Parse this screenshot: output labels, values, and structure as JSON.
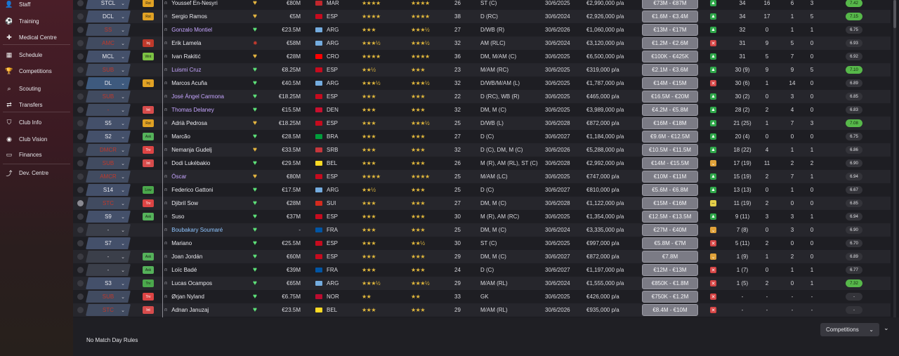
{
  "sidebar": {
    "items": [
      {
        "label": "Staff",
        "icon": "staff-icon",
        "glyph": "👤"
      },
      {
        "label": "Training",
        "icon": "training-icon",
        "glyph": "⚽"
      },
      {
        "label": "Medical Centre",
        "icon": "medical-icon",
        "glyph": "✚"
      },
      {
        "label": "Schedule",
        "icon": "schedule-icon",
        "glyph": "▦"
      },
      {
        "label": "Competitions",
        "icon": "trophy-icon",
        "glyph": "🏆"
      },
      {
        "label": "Scouting",
        "icon": "search-icon",
        "glyph": "⌕"
      },
      {
        "label": "Transfers",
        "icon": "transfers-icon",
        "glyph": "⇄"
      },
      {
        "label": "Club Info",
        "icon": "shield-icon",
        "glyph": "⛉"
      },
      {
        "label": "Club Vision",
        "icon": "eye-icon",
        "glyph": "◉"
      },
      {
        "label": "Finances",
        "icon": "money-icon",
        "glyph": "▭"
      },
      {
        "label": "Dev. Centre",
        "icon": "dev-icon",
        "glyph": "⤴"
      }
    ]
  },
  "players": [
    {
      "role": "STCL",
      "role_style": "normal",
      "badge": "Rst",
      "badge_class": "b-rst",
      "name": "Youssef En-Nesyri",
      "name_style": "normal",
      "heart": "gold",
      "value": "€80M",
      "flag": "#c1272d",
      "nat": "MAR",
      "ca": "★★★★",
      "pa": "★★★★",
      "age": "26",
      "pos": "ST (C)",
      "expires": "30/6/2025",
      "wage": "€2,990,000 p/a",
      "fee": "€73M - €87M",
      "status": "g",
      "apps": "34",
      "gls": "16",
      "ast": "6",
      "pom": "3",
      "rating": "7.42",
      "rating_green": true
    },
    {
      "role": "DCL",
      "role_style": "normal",
      "badge": "Rst",
      "badge_class": "b-rst",
      "name": "Sergio Ramos",
      "name_style": "normal",
      "heart": "gold",
      "value": "€5M",
      "flag": "#c60b1e",
      "nat": "ESP",
      "ca": "★★★★",
      "pa": "★★★★",
      "age": "38",
      "pos": "D (RC)",
      "expires": "30/6/2024",
      "wage": "€2,926,000 p/a",
      "fee": "€1.6M - €3.4M",
      "status": "g",
      "apps": "34",
      "gls": "17",
      "ast": "1",
      "pom": "5",
      "rating": "7.15",
      "rating_green": true
    },
    {
      "role": "SS",
      "role_style": "red",
      "badge": "",
      "badge_class": "",
      "name": "Gonzalo Montiel",
      "name_style": "purple",
      "heart": "green",
      "value": "€23.5M",
      "flag": "#74acdf",
      "nat": "ARG",
      "ca": "★★★",
      "pa": "★★★½",
      "age": "27",
      "pos": "D/WB (R)",
      "expires": "30/6/2026",
      "wage": "€1,060,000 p/a",
      "fee": "€13M - €17M",
      "status": "g",
      "apps": "32",
      "gls": "0",
      "ast": "1",
      "pom": "1",
      "rating": "6.75",
      "rating_green": false
    },
    {
      "role": "AMC",
      "role_style": "red",
      "badge": "Inj",
      "badge_class": "b-inj",
      "name": "Erik Lamela",
      "name_style": "normal",
      "heart": "red",
      "value": "€58M",
      "flag": "#74acdf",
      "nat": "ARG",
      "ca": "★★★½",
      "pa": "★★★½",
      "age": "32",
      "pos": "AM (RLC)",
      "expires": "30/6/2024",
      "wage": "€3,120,000 p/a",
      "fee": "€1.2M - €2.6M",
      "status": "r",
      "apps": "31",
      "gls": "9",
      "ast": "5",
      "pom": "0",
      "rating": "6.93",
      "rating_green": false
    },
    {
      "role": "MCL",
      "role_style": "normal",
      "badge": "Wnt",
      "badge_class": "b-wnt",
      "name": "Ivan Rakitić",
      "name_style": "normal",
      "heart": "gold",
      "value": "€28M",
      "flag": "#ff0000",
      "nat": "CRO",
      "ca": "★★★★",
      "pa": "★★★★",
      "age": "36",
      "pos": "DM, M/AM (C)",
      "expires": "30/6/2025",
      "wage": "€6,500,000 p/a",
      "fee": "€100K - €425K",
      "status": "g",
      "apps": "31",
      "gls": "5",
      "ast": "7",
      "pom": "0",
      "rating": "6.92",
      "rating_green": false
    },
    {
      "role": "SUB",
      "role_style": "red",
      "badge": "",
      "badge_class": "",
      "name": "Luismi Cruz",
      "name_style": "purple",
      "heart": "green",
      "value": "€8.25M",
      "flag": "#c60b1e",
      "nat": "ESP",
      "ca": "★★½",
      "pa": "★★★",
      "age": "23",
      "pos": "M/AM (RC)",
      "expires": "30/6/2025",
      "wage": "€319,000 p/a",
      "fee": "€2.1M - €3.6M",
      "status": "g",
      "apps": "30 (9)",
      "gls": "9",
      "ast": "9",
      "pom": "5",
      "rating": "7.10",
      "rating_green": true
    },
    {
      "role": "DL",
      "role_style": "blue",
      "badge": "Inj",
      "badge_class": "b-rst",
      "name": "Marcos Acuña",
      "name_style": "normal",
      "heart": "green",
      "value": "€40.5M",
      "flag": "#74acdf",
      "nat": "ARG",
      "ca": "★★★½",
      "pa": "★★★½",
      "age": "32",
      "pos": "D/WB/M/AM (L)",
      "expires": "30/6/2025",
      "wage": "€1,787,000 p/a",
      "fee": "€14M - €15M",
      "status": "r",
      "apps": "30 (6)",
      "gls": "1",
      "ast": "14",
      "pom": "0",
      "rating": "6.89",
      "rating_green": false
    },
    {
      "role": "SUB",
      "role_style": "red",
      "badge": "",
      "badge_class": "",
      "name": "José Ángel Carmona",
      "name_style": "purple",
      "heart": "green",
      "value": "€18.25M",
      "flag": "#c60b1e",
      "nat": "ESP",
      "ca": "★★★",
      "pa": "★★★",
      "age": "22",
      "pos": "D (RC), WB (R)",
      "expires": "30/6/2025",
      "wage": "€465,000 p/a",
      "fee": "€16.5M - €20M",
      "status": "g",
      "apps": "30 (2)",
      "gls": "0",
      "ast": "3",
      "pom": "0",
      "rating": "6.85",
      "rating_green": false
    },
    {
      "role": "-",
      "role_style": "red",
      "badge": "Int",
      "badge_class": "b-int",
      "name": "Thomas Delaney",
      "name_style": "purple",
      "heart": "green",
      "value": "€15.5M",
      "flag": "#c8102e",
      "nat": "DEN",
      "ca": "★★★",
      "pa": "★★★",
      "age": "32",
      "pos": "DM, M (C)",
      "expires": "30/6/2025",
      "wage": "€3,989,000 p/a",
      "fee": "€4.2M - €5.8M",
      "status": "g",
      "apps": "28 (2)",
      "gls": "2",
      "ast": "4",
      "pom": "0",
      "rating": "6.83",
      "rating_green": false
    },
    {
      "role": "S5",
      "role_style": "normal",
      "badge": "Rst",
      "badge_class": "b-rst",
      "name": "Adrià Pedrosa",
      "name_style": "normal",
      "heart": "gold",
      "value": "€18.25M",
      "flag": "#c60b1e",
      "nat": "ESP",
      "ca": "★★★",
      "pa": "★★★½",
      "age": "25",
      "pos": "D/WB (L)",
      "expires": "30/6/2028",
      "wage": "€872,000 p/a",
      "fee": "€16M - €18M",
      "status": "g",
      "apps": "21 (25)",
      "gls": "1",
      "ast": "7",
      "pom": "3",
      "rating": "7.08",
      "rating_green": true
    },
    {
      "role": "S2",
      "role_style": "normal",
      "badge": "Ask",
      "badge_class": "b-ask",
      "name": "Marcão",
      "name_style": "normal",
      "heart": "green",
      "value": "€28.5M",
      "flag": "#009c3b",
      "nat": "BRA",
      "ca": "★★★",
      "pa": "★★★",
      "age": "27",
      "pos": "D (C)",
      "expires": "30/6/2027",
      "wage": "€1,184,000 p/a",
      "fee": "€9.6M - €12.5M",
      "status": "g",
      "apps": "20 (4)",
      "gls": "0",
      "ast": "0",
      "pom": "0",
      "rating": "6.75",
      "rating_green": false
    },
    {
      "role": "DMCR",
      "role_style": "red",
      "badge": "Trv",
      "badge_class": "b-trv",
      "name": "Nemanja Gudelj",
      "name_style": "normal",
      "heart": "gold",
      "value": "€33.5M",
      "flag": "#c6363c",
      "nat": "SRB",
      "ca": "★★★",
      "pa": "★★★",
      "age": "32",
      "pos": "D (C), DM, M (C)",
      "expires": "30/6/2026",
      "wage": "€5,288,000 p/a",
      "fee": "€10.5M - €11.5M",
      "status": "g",
      "apps": "18 (22)",
      "gls": "4",
      "ast": "1",
      "pom": "1",
      "rating": "6.86",
      "rating_green": false
    },
    {
      "role": "SUB",
      "role_style": "red",
      "badge": "Int",
      "badge_class": "b-int",
      "name": "Dodi Lukébakio",
      "name_style": "normal",
      "heart": "green",
      "value": "€29.5M",
      "flag": "#fdda24",
      "nat": "BEL",
      "ca": "★★★",
      "pa": "★★★",
      "age": "26",
      "pos": "M (R), AM (RL), ST (C)",
      "expires": "30/6/2028",
      "wage": "€2,992,000 p/a",
      "fee": "€14M - €15.5M",
      "status": "o",
      "apps": "17 (19)",
      "gls": "11",
      "ast": "2",
      "pom": "2",
      "rating": "6.90",
      "rating_green": false
    },
    {
      "role": "AMCR",
      "role_style": "red",
      "badge": "",
      "badge_class": "",
      "name": "Óscar",
      "name_style": "purple",
      "heart": "gold",
      "value": "€80M",
      "flag": "#c60b1e",
      "nat": "ESP",
      "ca": "★★★★",
      "pa": "★★★★",
      "age": "25",
      "pos": "M/AM (LC)",
      "expires": "30/6/2025",
      "wage": "€747,000 p/a",
      "fee": "€10M - €11M",
      "status": "g",
      "apps": "15 (19)",
      "gls": "2",
      "ast": "7",
      "pom": "1",
      "rating": "6.94",
      "rating_green": false
    },
    {
      "role": "S14",
      "role_style": "normal",
      "badge": "Low",
      "badge_class": "b-low",
      "name": "Federico Gattoni",
      "name_style": "normal",
      "heart": "green",
      "value": "€17.5M",
      "flag": "#74acdf",
      "nat": "ARG",
      "ca": "★★½",
      "pa": "★★★",
      "age": "25",
      "pos": "D (C)",
      "expires": "30/6/2027",
      "wage": "€810,000 p/a",
      "fee": "€5.6M - €6.8M",
      "status": "g",
      "apps": "13 (13)",
      "gls": "0",
      "ast": "1",
      "pom": "0",
      "rating": "6.67",
      "rating_green": false
    },
    {
      "role": "STC",
      "role_style": "red",
      "badge": "Trv",
      "badge_class": "b-trv",
      "name": "Djibril Sow",
      "name_style": "normal",
      "heart": "green",
      "value": "€28M",
      "flag": "#d52b1e",
      "nat": "SUI",
      "ca": "★★★",
      "pa": "★★★",
      "age": "27",
      "pos": "DM, M (C)",
      "expires": "30/6/2028",
      "wage": "€1,122,000 p/a",
      "fee": "€15M - €16M",
      "status": "y",
      "apps": "11 (19)",
      "gls": "2",
      "ast": "0",
      "pom": "0",
      "rating": "6.85",
      "rating_green": false
    },
    {
      "role": "S9",
      "role_style": "normal",
      "badge": "Ask",
      "badge_class": "b-ask",
      "name": "Suso",
      "name_style": "normal",
      "heart": "green",
      "value": "€37M",
      "flag": "#c60b1e",
      "nat": "ESP",
      "ca": "★★★",
      "pa": "★★★",
      "age": "30",
      "pos": "M (R), AM (RC)",
      "expires": "30/6/2025",
      "wage": "€1,354,000 p/a",
      "fee": "€12.5M - €13.5M",
      "status": "g",
      "apps": "9 (11)",
      "gls": "3",
      "ast": "3",
      "pom": "1",
      "rating": "6.94",
      "rating_green": false
    },
    {
      "role": "-",
      "role_style": "gray",
      "badge": "",
      "badge_class": "",
      "name": "Boubakary Soumaré",
      "name_style": "blue",
      "heart": "green",
      "value": "-",
      "flag": "#0055a4",
      "nat": "FRA",
      "ca": "★★★",
      "pa": "★★★",
      "age": "25",
      "pos": "DM, M (C)",
      "expires": "30/6/2024",
      "wage": "€3,335,000 p/a",
      "fee": "€27M - €40M",
      "status": "o",
      "apps": "7 (8)",
      "gls": "0",
      "ast": "3",
      "pom": "0",
      "rating": "6.90",
      "rating_green": false
    },
    {
      "role": "S7",
      "role_style": "normal",
      "badge": "",
      "badge_class": "",
      "name": "Mariano",
      "name_style": "normal",
      "heart": "green",
      "value": "€25.5M",
      "flag": "#c60b1e",
      "nat": "ESP",
      "ca": "★★★",
      "pa": "★★½",
      "age": "30",
      "pos": "ST (C)",
      "expires": "30/6/2025",
      "wage": "€997,000 p/a",
      "fee": "€5.8M - €7M",
      "status": "r",
      "apps": "5 (11)",
      "gls": "2",
      "ast": "0",
      "pom": "0",
      "rating": "6.70",
      "rating_green": false
    },
    {
      "role": "-",
      "role_style": "gray",
      "badge": "Ask",
      "badge_class": "b-ask",
      "name": "Joan Jordán",
      "name_style": "normal",
      "heart": "green",
      "value": "€60M",
      "flag": "#c60b1e",
      "nat": "ESP",
      "ca": "★★★",
      "pa": "★★★",
      "age": "29",
      "pos": "DM, M (C)",
      "expires": "30/6/2027",
      "wage": "€872,000 p/a",
      "fee": "€7.8M",
      "status": "o",
      "apps": "1 (9)",
      "gls": "1",
      "ast": "2",
      "pom": "0",
      "rating": "6.89",
      "rating_green": false
    },
    {
      "role": "-",
      "role_style": "gray",
      "badge": "Ask",
      "badge_class": "b-ask",
      "name": "Loïc Badé",
      "name_style": "normal",
      "heart": "green",
      "value": "€39M",
      "flag": "#0055a4",
      "nat": "FRA",
      "ca": "★★★",
      "pa": "★★★",
      "age": "24",
      "pos": "D (C)",
      "expires": "30/6/2027",
      "wage": "€1,197,000 p/a",
      "fee": "€12M - €13M",
      "status": "r",
      "apps": "1 (7)",
      "gls": "0",
      "ast": "1",
      "pom": "1",
      "rating": "6.77",
      "rating_green": false
    },
    {
      "role": "S3",
      "role_style": "normal",
      "badge": "Trv",
      "badge_class": "b-low",
      "name": "Lucas Ocampos",
      "name_style": "normal",
      "heart": "green",
      "value": "€65M",
      "flag": "#74acdf",
      "nat": "ARG",
      "ca": "★★★½",
      "pa": "★★★½",
      "age": "29",
      "pos": "M/AM (RL)",
      "expires": "30/6/2024",
      "wage": "€1,555,000 p/a",
      "fee": "€850K - €1.8M",
      "status": "r",
      "apps": "1 (5)",
      "gls": "2",
      "ast": "0",
      "pom": "1",
      "rating": "7.32",
      "rating_green": true
    },
    {
      "role": "SUB",
      "role_style": "red",
      "badge": "Trv",
      "badge_class": "b-trv",
      "name": "Ørjan Nyland",
      "name_style": "normal",
      "heart": "green",
      "value": "€6.75M",
      "flag": "#ba0c2f",
      "nat": "NOR",
      "ca": "★★",
      "pa": "★★",
      "age": "33",
      "pos": "GK",
      "expires": "30/6/2025",
      "wage": "€426,000 p/a",
      "fee": "€750K - €1.2M",
      "status": "r",
      "apps": "-",
      "gls": "-",
      "ast": "-",
      "pom": "-",
      "rating": "-",
      "rating_green": false
    },
    {
      "role": "STC",
      "role_style": "red",
      "badge": "Int",
      "badge_class": "b-int",
      "name": "Adnan Januzaj",
      "name_style": "normal",
      "heart": "green",
      "value": "€23.5M",
      "flag": "#fdda24",
      "nat": "BEL",
      "ca": "★★★",
      "pa": "★★★",
      "age": "29",
      "pos": "M/AM (RL)",
      "expires": "30/6/2026",
      "wage": "€935,000 p/a",
      "fee": "€8.4M - €10M",
      "status": "r",
      "apps": "-",
      "gls": "-",
      "ast": "-",
      "pom": "-",
      "rating": "-",
      "rating_green": false
    }
  ],
  "footer": {
    "no_match_day_rules": "No Match Day Rules",
    "competitions_label": "Competitions"
  },
  "colors": {
    "accent_green": "#5ee37a",
    "star_gold": "#e3b93c",
    "sidebar_maroon": "#4a1e28"
  }
}
